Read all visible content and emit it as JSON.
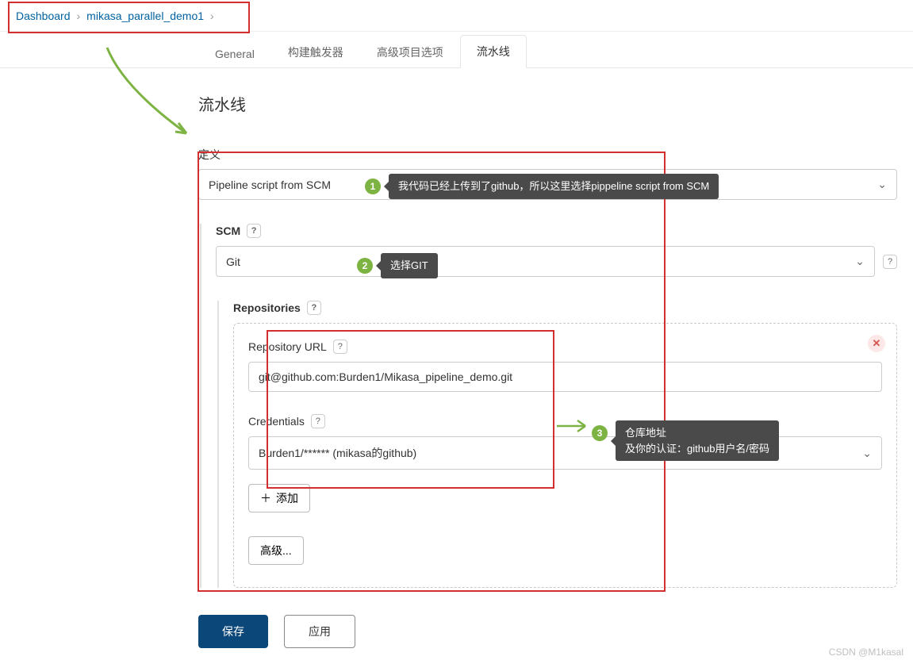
{
  "breadcrumb": {
    "dashboard": "Dashboard",
    "project": "mikasa_parallel_demo1"
  },
  "tabs": {
    "general": "General",
    "triggers": "构建触发器",
    "advanced": "高级项目选项",
    "pipeline": "流水线"
  },
  "section_title": "流水线",
  "definition_label": "定义",
  "definition_value": "Pipeline script from SCM",
  "scm": {
    "label": "SCM",
    "value": "Git"
  },
  "repositories_label": "Repositories",
  "repo_url_label": "Repository URL",
  "repo_url_value": "git@github.com:Burden1/Mikasa_pipeline_demo.git",
  "credentials_label": "Credentials",
  "credentials_value": "Burden1/****** (mikasa的github)",
  "add_button": "添加",
  "advanced_button": "高级...",
  "save_button": "保存",
  "apply_button": "应用",
  "callouts": {
    "c1": "我代码已经上传到了github，所以这里选择pippeline script from SCM",
    "c2": "选择GIT",
    "c3": "仓库地址\n及你的认证：github用户名/密码"
  },
  "watermark": "CSDN @M1kasal"
}
